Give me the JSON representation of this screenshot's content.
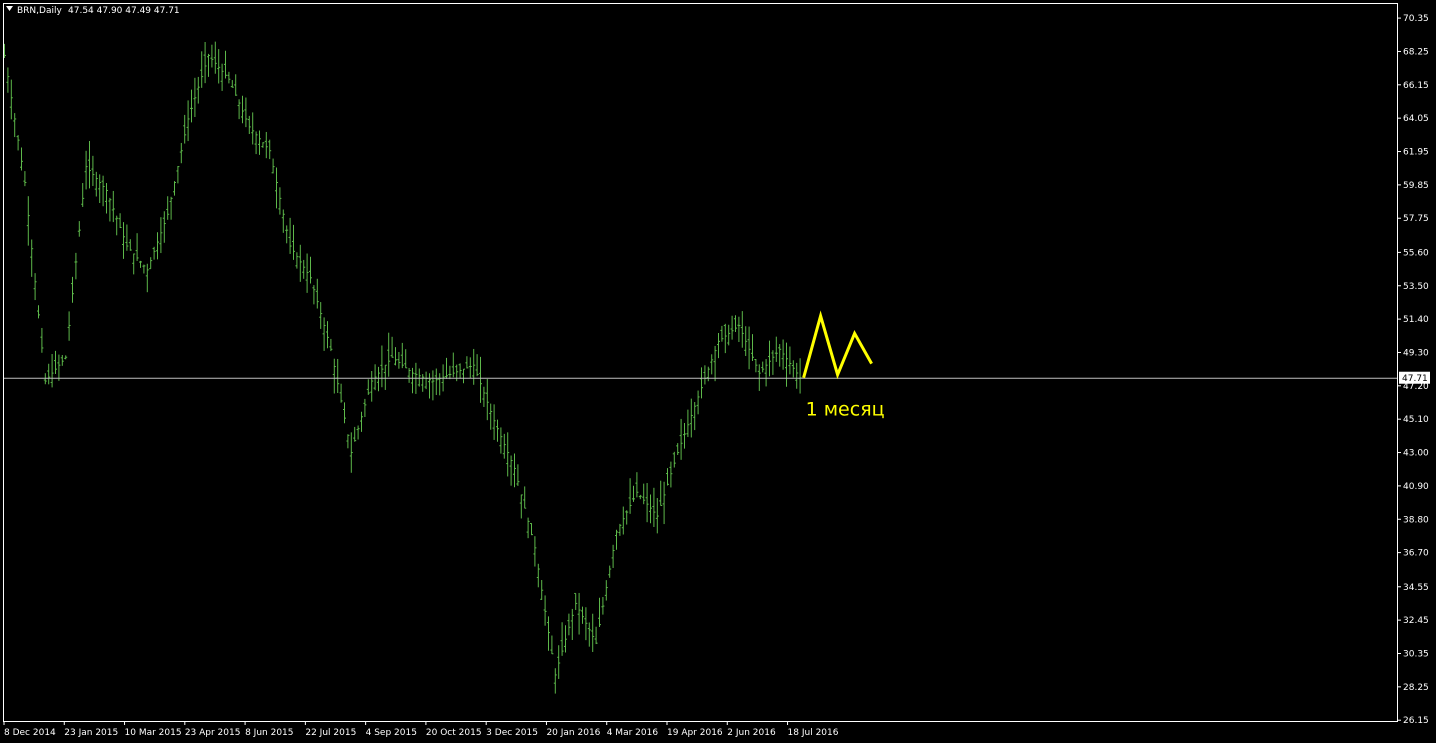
{
  "header": {
    "symbol_label": "BRN,Daily",
    "ohlc_label": "47.54 47.90 47.49 47.71"
  },
  "colors": {
    "background": "#000000",
    "frame": "#ffffff",
    "bars": "#5db84a",
    "price_line": "#c0c0c0",
    "forecast": "#ffff00",
    "price_tag_bg": "#ffffff"
  },
  "current_price": {
    "value": 47.71,
    "label": "47.71"
  },
  "annotation": {
    "text": "1 месяц"
  },
  "chart_data": {
    "type": "ohlc",
    "title": "",
    "xlabel": "",
    "ylabel": "",
    "ylim": [
      26.1,
      71.3
    ],
    "grid": false,
    "y_ticks": [
      70.35,
      68.25,
      66.15,
      64.05,
      61.95,
      59.85,
      57.75,
      55.6,
      53.5,
      51.4,
      49.3,
      47.2,
      45.1,
      43.0,
      40.9,
      38.8,
      36.7,
      34.55,
      32.45,
      30.35,
      28.25,
      26.15
    ],
    "x_tick_labels": [
      "8 Dec 2014",
      "23 Jan 2015",
      "10 Mar 2015",
      "23 Apr 2015",
      "8 Jun 2015",
      "22 Jul 2015",
      "4 Sep 2015",
      "20 Oct 2015",
      "3 Dec 2015",
      "20 Jan 2016",
      "4 Mar 2016",
      "19 Apr 2016",
      "2 Jun 2016",
      "18 Jul 2016"
    ],
    "series": [
      {
        "dates": [
          "8 Dec 2014",
          "15 Dec 2014",
          "13 Jan 2015",
          "23 Jan 2015",
          "3 Feb 2015",
          "20 Feb 2015",
          "10 Mar 2015",
          "17 Mar 2015",
          "6 Apr 2015",
          "23 Apr 2015",
          "6 May 2015",
          "13 May 2015",
          "8 Jun 2015",
          "22 Jun 2015",
          "7 Jul 2015",
          "22 Jul 2015",
          "10 Aug 2015",
          "24 Aug 2015",
          "31 Aug 2015",
          "4 Sep 2015",
          "21 Sep 2015",
          "9 Oct 2015",
          "20 Oct 2015",
          "2 Nov 2015",
          "16 Nov 2015",
          "3 Dec 2015",
          "14 Dec 2015",
          "20 Jan 2016",
          "1 Feb 2016",
          "11 Feb 2016",
          "4 Mar 2016",
          "21 Mar 2016",
          "5 Apr 2016",
          "19 Apr 2016",
          "4 May 2016",
          "2 Jun 2016",
          "10 Jun 2016",
          "23 Jun 2016",
          "6 Jul 2016",
          "18 Jul 2016"
        ],
        "closes": [
          68.0,
          60.0,
          47.5,
          49.0,
          61.0,
          59.5,
          56.0,
          54.5,
          58.0,
          64.0,
          68.0,
          66.5,
          63.5,
          62.0,
          56.0,
          54.0,
          49.5,
          43.0,
          47.5,
          49.0,
          48.0,
          47.5,
          48.0,
          48.5,
          45.0,
          42.0,
          37.0,
          29.0,
          33.5,
          31.0,
          38.0,
          40.5,
          39.0,
          43.0,
          46.5,
          50.0,
          51.0,
          48.0,
          49.5,
          47.71
        ]
      }
    ],
    "forecast": {
      "description": "",
      "values": [
        47.71,
        51.6,
        47.9,
        50.5,
        48.6
      ]
    }
  }
}
